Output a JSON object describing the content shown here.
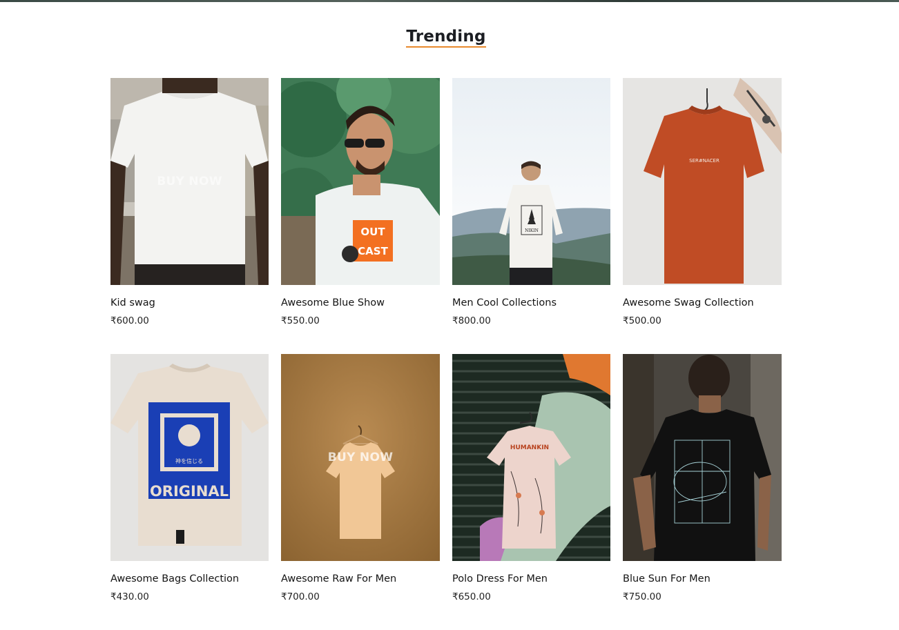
{
  "section": {
    "title": "Trending"
  },
  "products": [
    {
      "name": "Kid swag",
      "price": "₹600.00",
      "overlay": "BUY NOW"
    },
    {
      "name": "Awesome Blue Show",
      "price": "₹550.00",
      "overlay": ""
    },
    {
      "name": "Men Cool Collections",
      "price": "₹800.00",
      "overlay": ""
    },
    {
      "name": "Awesome Swag Collection",
      "price": "₹500.00",
      "overlay": ""
    },
    {
      "name": "Awesome Bags Collection",
      "price": "₹430.00",
      "overlay": ""
    },
    {
      "name": "Awesome Raw For Men",
      "price": "₹700.00",
      "overlay": "BUY NOW"
    },
    {
      "name": "Polo Dress For Men",
      "price": "₹650.00",
      "overlay": ""
    },
    {
      "name": "Blue Sun For Men",
      "price": "₹750.00",
      "overlay": ""
    }
  ],
  "graphics": {
    "p1_shirt_text": "",
    "p2_shirt_text": [
      "OUT",
      "CAST"
    ],
    "p3_shirt_text": "NIKIN",
    "p4_shirt_text": "SER#NACER",
    "p5_shirt_text": [
      "ORIGINAL",
      "神を信じる"
    ],
    "p7_shirt_text": "HUMANKIN"
  }
}
